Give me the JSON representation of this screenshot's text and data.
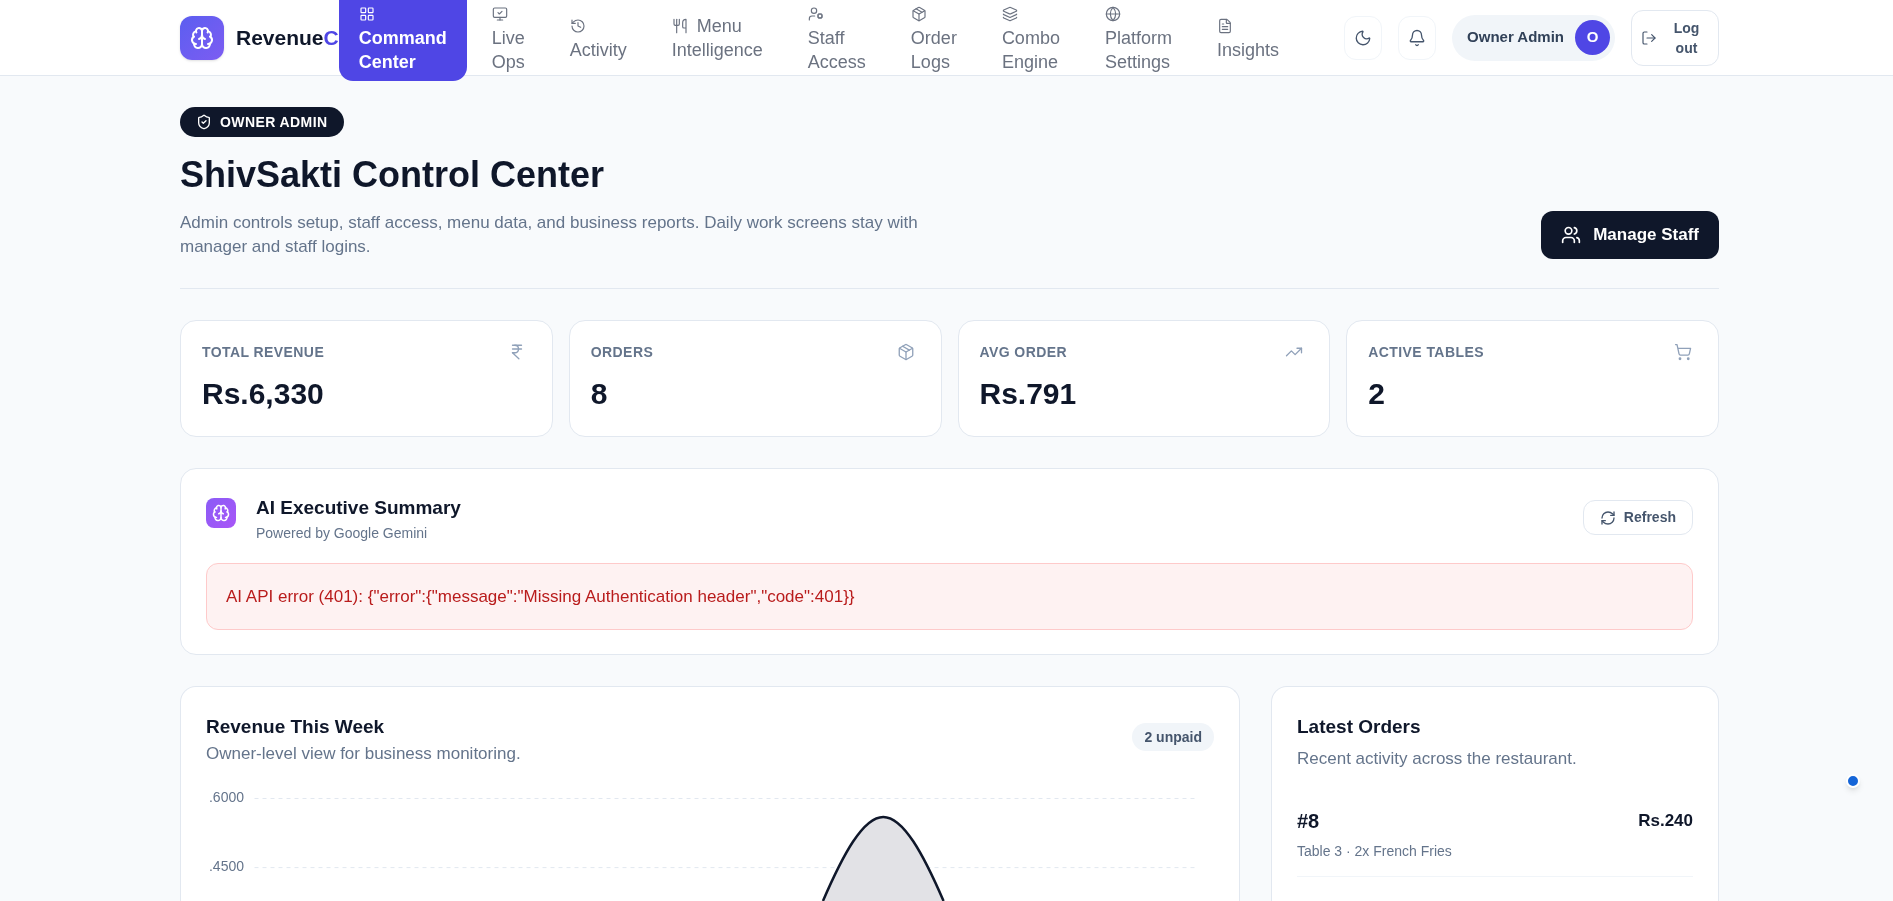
{
  "header": {
    "brand": {
      "name": "Revenue",
      "accent": "C"
    },
    "nav": [
      {
        "label": "Command Center",
        "selected": true
      },
      {
        "label": "Live Ops",
        "selected": false
      },
      {
        "label": "Activity",
        "selected": false
      },
      {
        "label": "Menu Intelligence",
        "selected": false
      },
      {
        "label": "Staff Access",
        "selected": false
      },
      {
        "label": "Order Logs",
        "selected": false
      },
      {
        "label": "Combo Engine",
        "selected": false
      },
      {
        "label": "Platform Settings",
        "selected": false
      },
      {
        "label": "Insights",
        "selected": false
      }
    ],
    "user": {
      "name": "Owner Admin",
      "initial": "O"
    },
    "logout": "Log out"
  },
  "intro": {
    "badge": "OWNER ADMIN",
    "title": "ShivSakti Control Center",
    "description": "Admin controls setup, staff access, menu data, and business reports. Daily work screens stay with manager and staff logins.",
    "action": "Manage Staff"
  },
  "stats": [
    {
      "label": "TOTAL REVENUE",
      "value": "Rs.6,330"
    },
    {
      "label": "ORDERS",
      "value": "8"
    },
    {
      "label": "AVG ORDER",
      "value": "Rs.791"
    },
    {
      "label": "ACTIVE TABLES",
      "value": "2"
    }
  ],
  "ai_summary": {
    "title": "AI Executive Summary",
    "subtitle": "Powered by Google Gemini",
    "refresh": "Refresh",
    "error": "AI API error (401): {\"error\":{\"message\":\"Missing Authentication header\",\"code\":401}}"
  },
  "revenue": {
    "title": "Revenue This Week",
    "subtitle": "Owner-level view for business monitoring.",
    "badge": "2 unpaid",
    "y_axis_labels": [
      ".6000",
      ".4500"
    ]
  },
  "latest_orders": {
    "title": "Latest Orders",
    "subtitle": "Recent activity across the restaurant.",
    "orders": [
      {
        "number": "#8",
        "amount": "Rs.240",
        "detail": "Table 3 · 2x French Fries"
      }
    ]
  }
}
